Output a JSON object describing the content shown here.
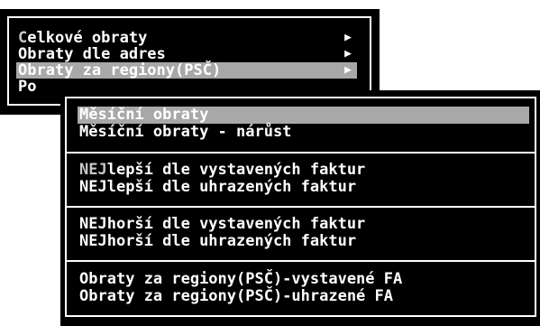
{
  "main_menu": {
    "items": [
      {
        "hotkey": "C",
        "rest": "elkové obraty",
        "arrow": "▶"
      },
      {
        "hotkey": "O",
        "rest": "braty dle adres",
        "arrow": "▶"
      },
      {
        "hotkey": "O",
        "rest": "braty za regiony(PSČ)",
        "arrow": "▶"
      },
      {
        "hotkey": "Po",
        "rest": "",
        "arrow": ""
      }
    ]
  },
  "sub_menu": {
    "items": [
      {
        "hotkey": "M",
        "rest": "ěsíční obraty"
      },
      {
        "hotkey": "M",
        "rest": "ěsíční obraty - nárůst"
      },
      {
        "hotkey": "NEJ",
        "rest": "lepší dle vystavených faktur"
      },
      {
        "hotkey": "NEJ",
        "rest": "lepší dle uhrazených faktur"
      },
      {
        "hotkey": "NEJ",
        "rest": "horší dle vystavených faktur"
      },
      {
        "hotkey": "NEJ",
        "rest": "horší dle uhrazených faktur"
      },
      {
        "hotkey": "O",
        "rest": "braty za regiony(PSČ)-vystavené FA"
      },
      {
        "hotkey": "O",
        "rest": "braty za regiony(PSČ)-uhrazené FA"
      }
    ]
  },
  "colors": {
    "background": "#000000",
    "text": "#ffffff",
    "highlight": "#a8a8a8"
  }
}
